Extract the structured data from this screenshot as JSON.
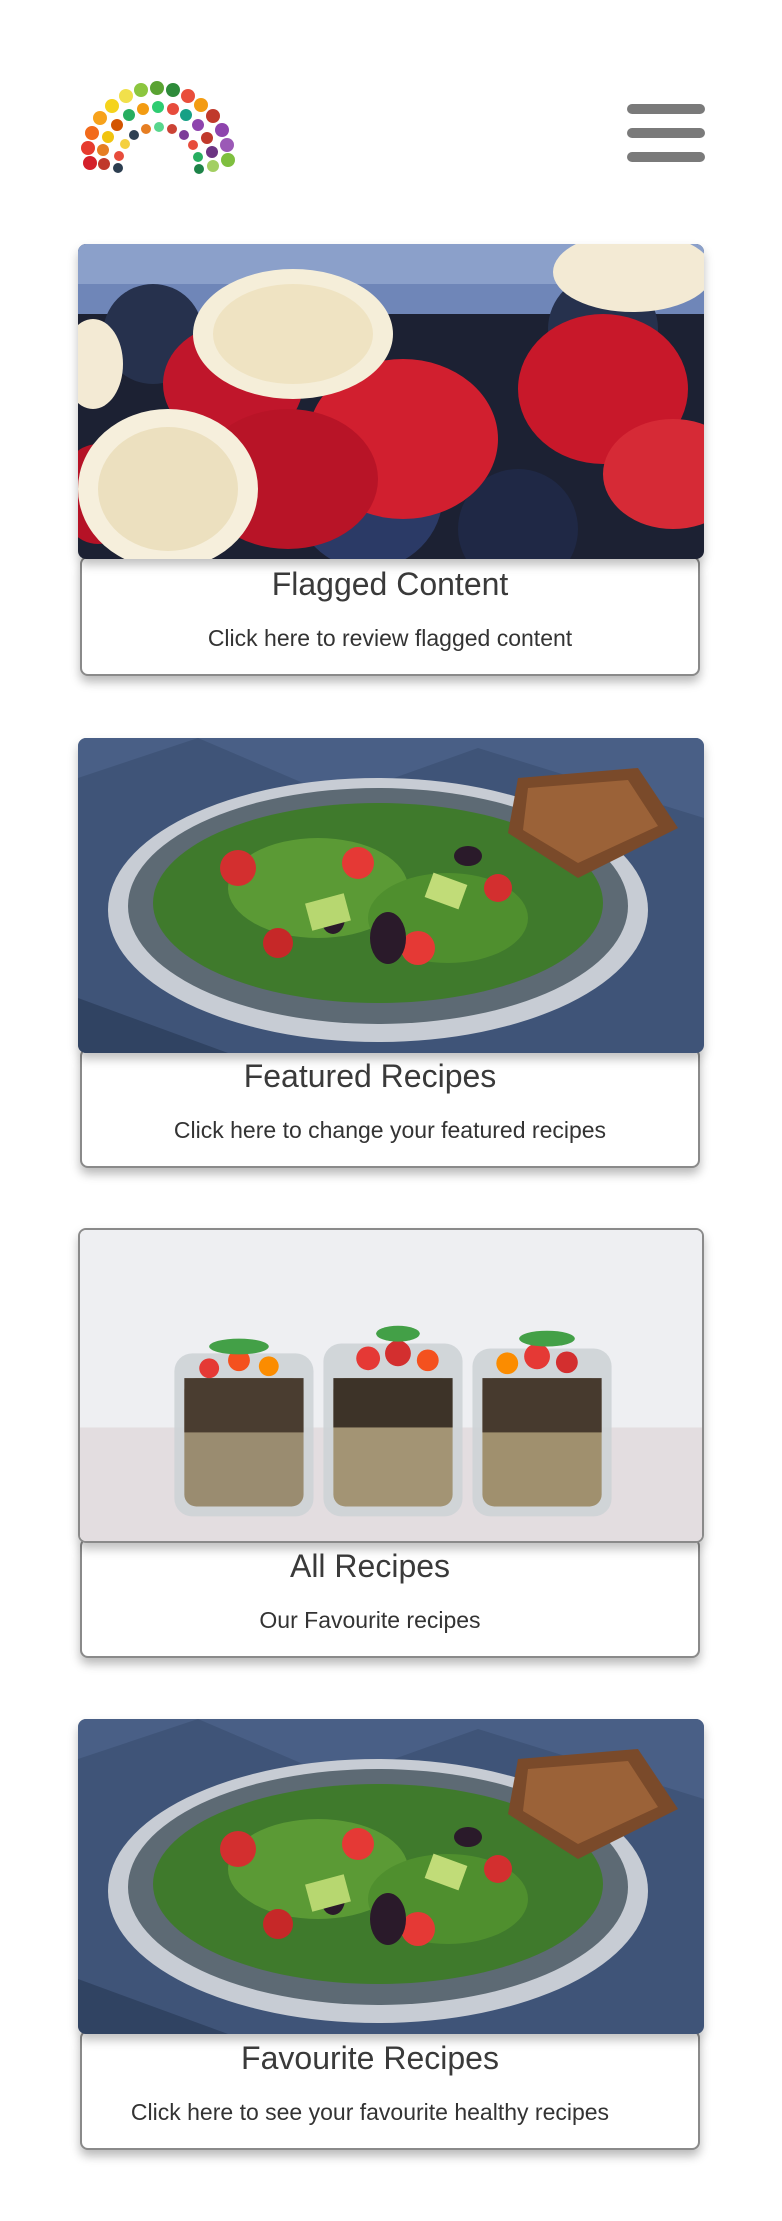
{
  "header": {
    "logo_icon": "fruit-and-vegetable-rainbow-logo",
    "menu_icon": "hamburger-menu-icon"
  },
  "cards": [
    {
      "title": "Flagged Content",
      "description": "Click here to review flagged content",
      "image_icon": "fruit-bowl-image"
    },
    {
      "title": "Featured Recipes",
      "description": "Click here to change your featured recipes",
      "image_icon": "salad-bowl-image"
    },
    {
      "title": "All Recipes",
      "description": "Our Favourite recipes",
      "image_icon": "salad-jars-image"
    },
    {
      "title": "Favourite Recipes",
      "description": "Click here to see your favourite healthy recipes",
      "image_icon": "salad-bowl-image"
    }
  ],
  "colors": {
    "menu_bar": "#7a7a7a",
    "card_border": "#8a8a8a",
    "text": "#333333",
    "background": "#ffffff"
  }
}
